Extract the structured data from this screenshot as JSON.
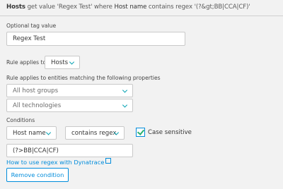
{
  "header": {
    "entity": "Hosts",
    "text1": " get value 'Regex Test' where ",
    "field": "Host name",
    "text2": " contains regex '(?&gt;BB|CCA|CF)'"
  },
  "tag_value": {
    "label": "Optional tag value",
    "value": "Regex Test"
  },
  "rule_applies": {
    "label": "Rule applies to",
    "selected": "Hosts"
  },
  "entity_filters": {
    "label": "Rule applies to entities matching the following properties",
    "host_groups": "All host groups",
    "technologies": "All technologies"
  },
  "conditions": {
    "label": "Conditions",
    "property": "Host name",
    "operator": "contains regex",
    "case_sensitive_label": "Case sensitive",
    "case_sensitive": true,
    "value": "(?>BB|CCA|CF)"
  },
  "help_link": "How to use regex with Dynatrace",
  "remove_button": "Remove condition",
  "colors": {
    "accent": "#008cdb",
    "check": "#2ab06f",
    "chevron": "#00a1b2"
  }
}
